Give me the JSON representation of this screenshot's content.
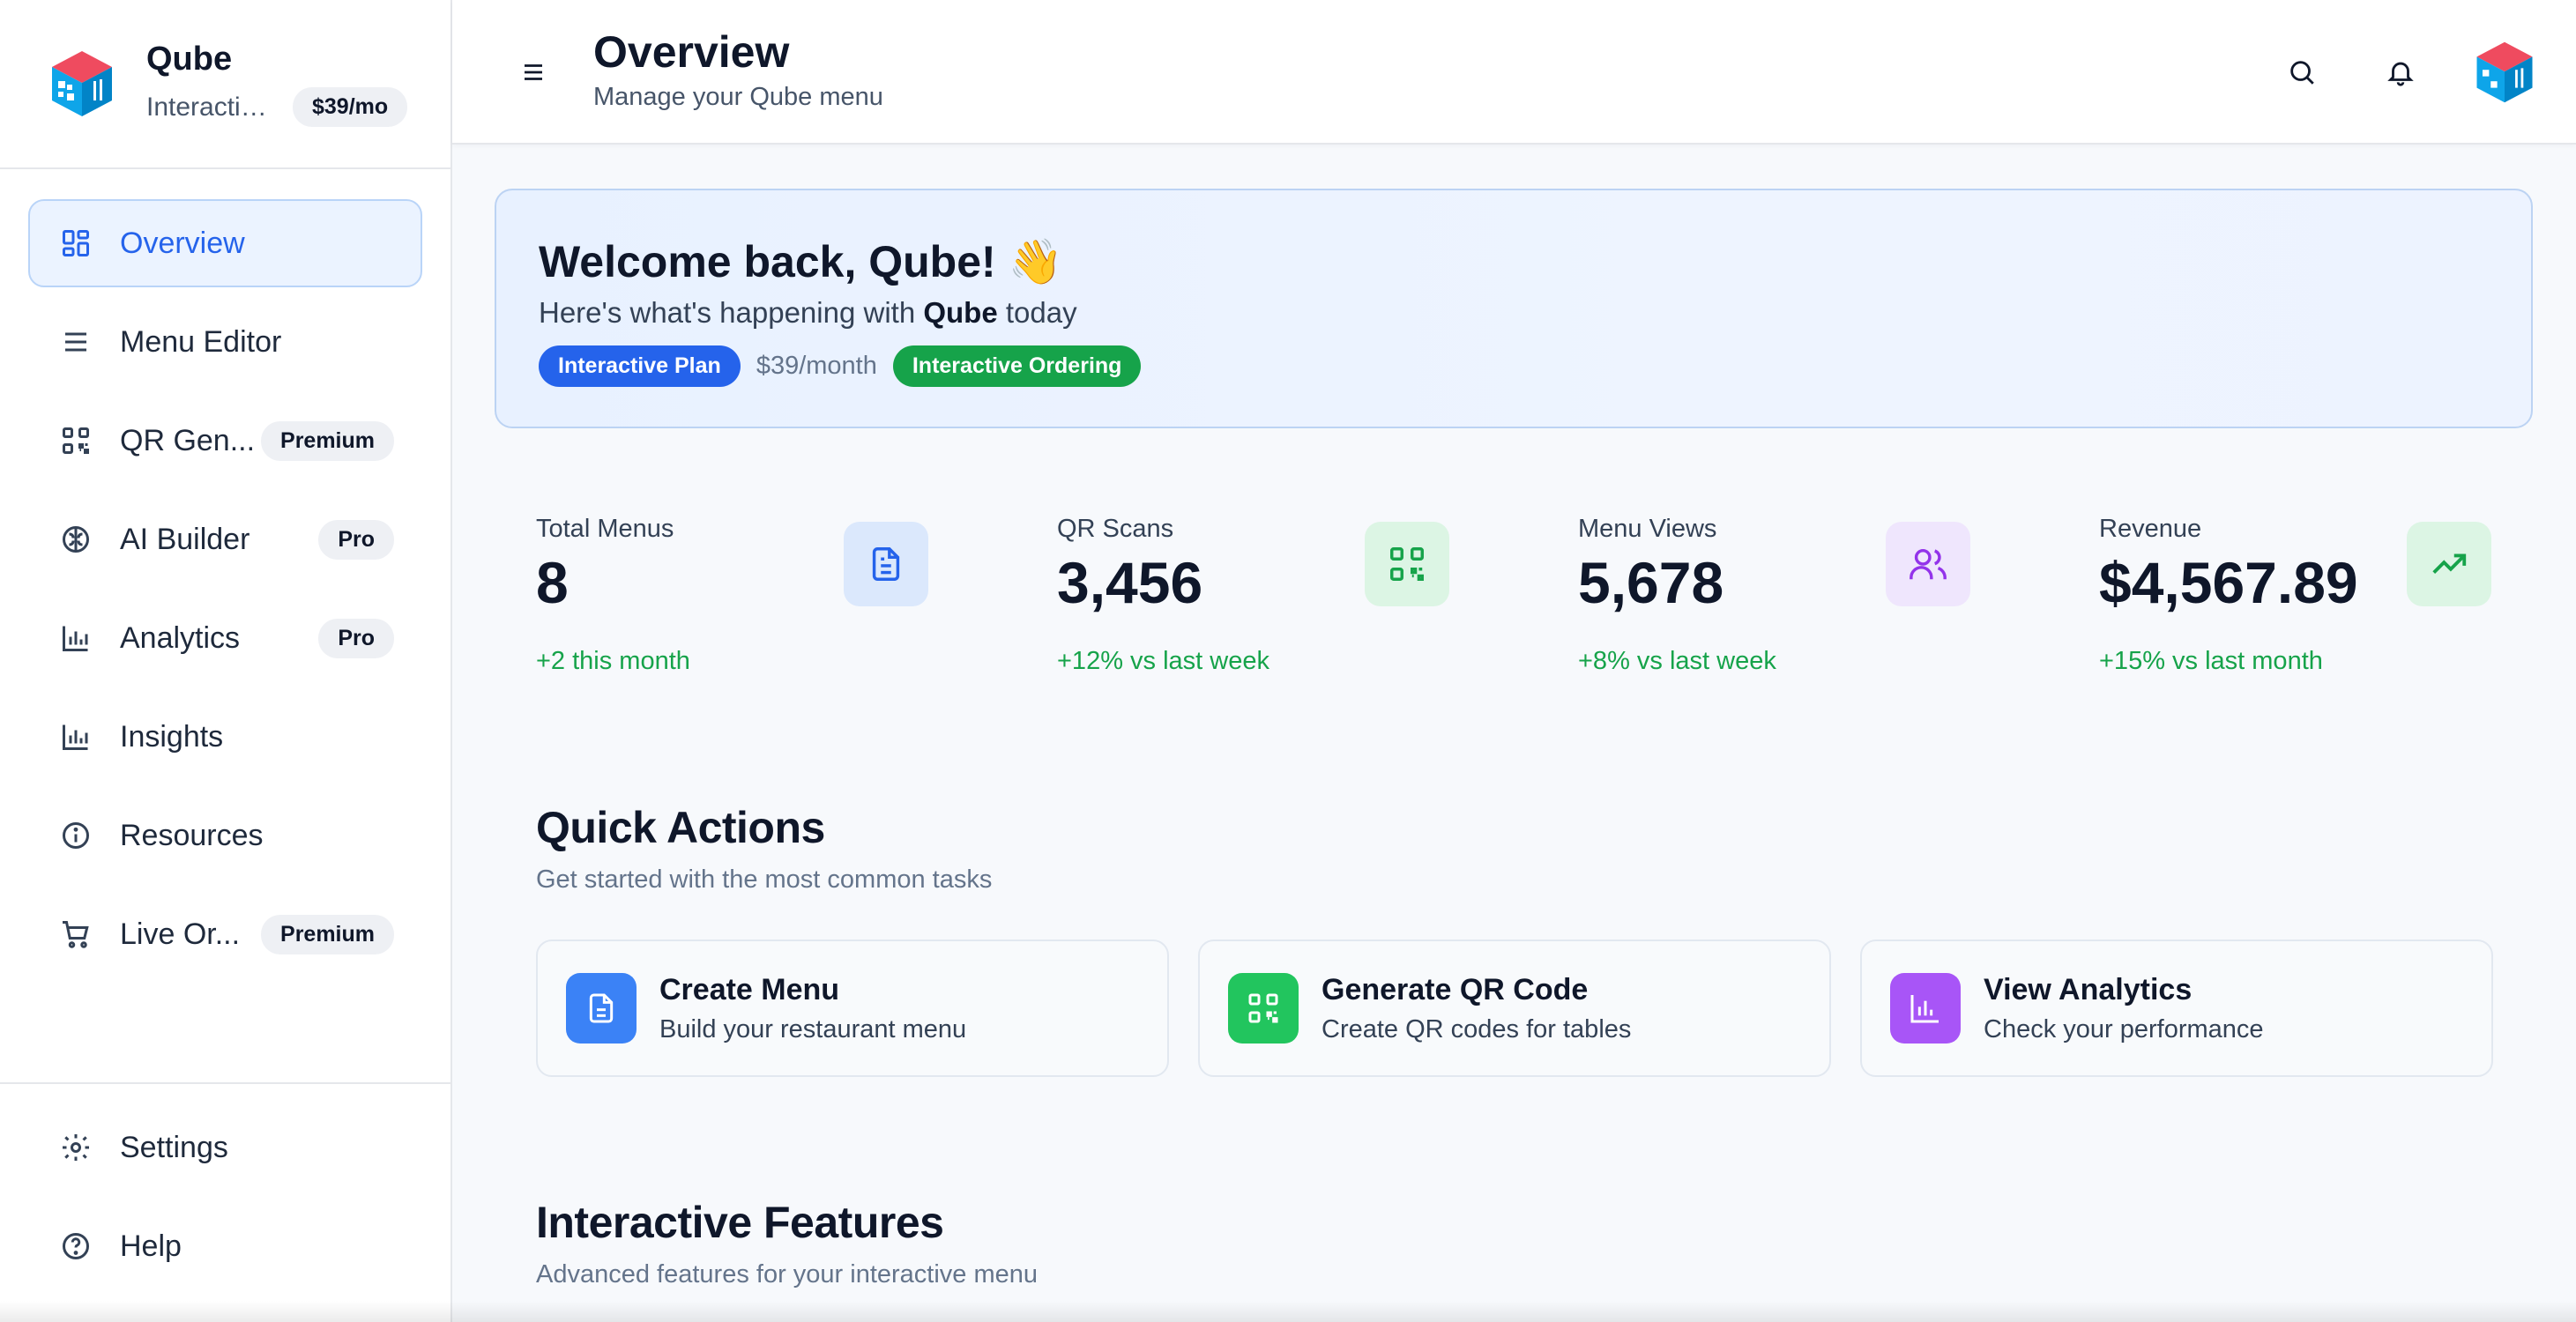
{
  "brand": {
    "name": "Qube",
    "plan": "Interactive Plan",
    "price": "$39/mo"
  },
  "sidebar": {
    "items": [
      {
        "label": "Overview",
        "icon": "dashboard-icon",
        "badge": "",
        "active": true
      },
      {
        "label": "Menu Editor",
        "icon": "list-icon",
        "badge": ""
      },
      {
        "label": "QR Gen...",
        "icon": "qr-code-icon",
        "badge": "Premium"
      },
      {
        "label": "AI Builder",
        "icon": "brain-icon",
        "badge": "Pro"
      },
      {
        "label": "Analytics",
        "icon": "bar-chart-icon",
        "badge": "Pro"
      },
      {
        "label": "Insights",
        "icon": "bar-chart-icon",
        "badge": ""
      },
      {
        "label": "Resources",
        "icon": "info-icon",
        "badge": ""
      },
      {
        "label": "Live Or...",
        "icon": "cart-icon",
        "badge": "Premium"
      }
    ],
    "bottom": [
      {
        "label": "Settings",
        "icon": "gear-icon"
      },
      {
        "label": "Help",
        "icon": "help-circle-icon"
      }
    ]
  },
  "header": {
    "title": "Overview",
    "subtitle": "Manage your Qube menu"
  },
  "welcome": {
    "title": "Welcome back, Qube! 👋",
    "sub_prefix": "Here's what's happening with ",
    "sub_name": "Qube",
    "sub_suffix": " today",
    "plan_tag": "Interactive Plan",
    "price": "$39/month",
    "feature_tag": "Interactive Ordering"
  },
  "stats": [
    {
      "label": "Total Menus",
      "value": "8",
      "change": "+2 this month",
      "icon": "document-icon",
      "color": "#2563eb"
    },
    {
      "label": "QR Scans",
      "value": "3,456",
      "change": "+12% vs last week",
      "icon": "qr-code-icon",
      "color": "#16a34a"
    },
    {
      "label": "Menu Views",
      "value": "5,678",
      "change": "+8% vs last week",
      "icon": "users-icon",
      "color": "#9333ea"
    },
    {
      "label": "Revenue",
      "value": "$4,567.89",
      "change": "+15% vs last month",
      "icon": "trending-up-icon",
      "color": "#16a34a"
    }
  ],
  "quick_actions": {
    "title": "Quick Actions",
    "subtitle": "Get started with the most common tasks",
    "items": [
      {
        "title": "Create Menu",
        "subtitle": "Build your restaurant menu",
        "icon": "document-icon",
        "color": "#3b82f6"
      },
      {
        "title": "Generate QR Code",
        "subtitle": "Create QR codes for tables",
        "icon": "qr-code-icon",
        "color": "#22c55e"
      },
      {
        "title": "View Analytics",
        "subtitle": "Check your performance",
        "icon": "bar-chart-icon",
        "color": "#a855f7"
      }
    ]
  },
  "features": {
    "title": "Interactive Features",
    "subtitle": "Advanced features for your interactive menu"
  },
  "colors": {
    "accent": "#2563eb",
    "positive": "#16a34a",
    "brand_red": "#ef4444",
    "brand_blue": "#0ea5e9"
  }
}
